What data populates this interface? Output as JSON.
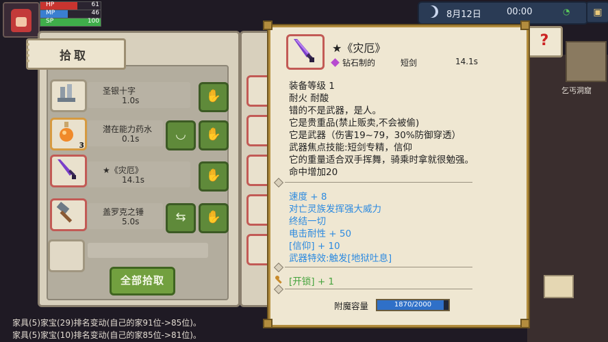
{
  "hud": {
    "hp_label": "HP",
    "hp_value": "61",
    "mp_label": "MP",
    "mp_value": "46",
    "sp_label": "SP",
    "sp_value": "100",
    "date": "8月12日",
    "time": "00:00"
  },
  "colors": {
    "hp": "#c8342f",
    "mp": "#3a7fd0",
    "sp": "#3fae4a",
    "blue_text": "#2c8ae0",
    "green_text": "#46a33e"
  },
  "pickup": {
    "title": "拾取",
    "items": [
      {
        "icon": "silver-cross-icon",
        "name": "圣银十字",
        "time": "1.0s"
      },
      {
        "icon": "potion-icon",
        "name": "潜在能力药水",
        "time": "0.1s",
        "count": "3"
      },
      {
        "icon": "sword-icon",
        "name": "★《灾厄》",
        "time": "14.1s"
      },
      {
        "icon": "hammer-icon",
        "name": "盖罗克之锤",
        "time": "5.0s"
      }
    ],
    "pick_all_label": "全部拾取"
  },
  "tooltip": {
    "title": "★《灾厄》",
    "material": "钻石制的",
    "weapon_type": "短剑",
    "duration": "14.1s",
    "description": [
      "装备等级 1",
      "耐火  耐酸",
      "错的不是武器，是人。",
      "它是贵重品(禁止贩卖,不会被偷)",
      "它是武器（伤害19~79，30%防御穿透）",
      "武器焦点技能:短剑专精，信仰",
      "它的重量适合双手挥舞，骑乘时拿就很勉强。",
      "命中增加20"
    ],
    "enchant_lines": [
      "速度 + 8",
      "对亡灵族发挥强大威力",
      "终结一切",
      "电击耐性 + 50",
      "[信仰] + 10",
      "武器特效:触发[地狱吐息]"
    ],
    "unlock_line": "[开锁] + 1",
    "enchant_capacity_label": "附魔容量",
    "enchant_capacity_text": "1870/2000",
    "enchant_capacity_fraction": 0.935
  },
  "map": {
    "location_name": "乞丐洞窟"
  },
  "log": [
    "家具(5)家宝(29)排名变动(自己的家91位->85位)。",
    "家具(5)家宝(10)排名变动(自己的家85位->81位)。"
  ]
}
